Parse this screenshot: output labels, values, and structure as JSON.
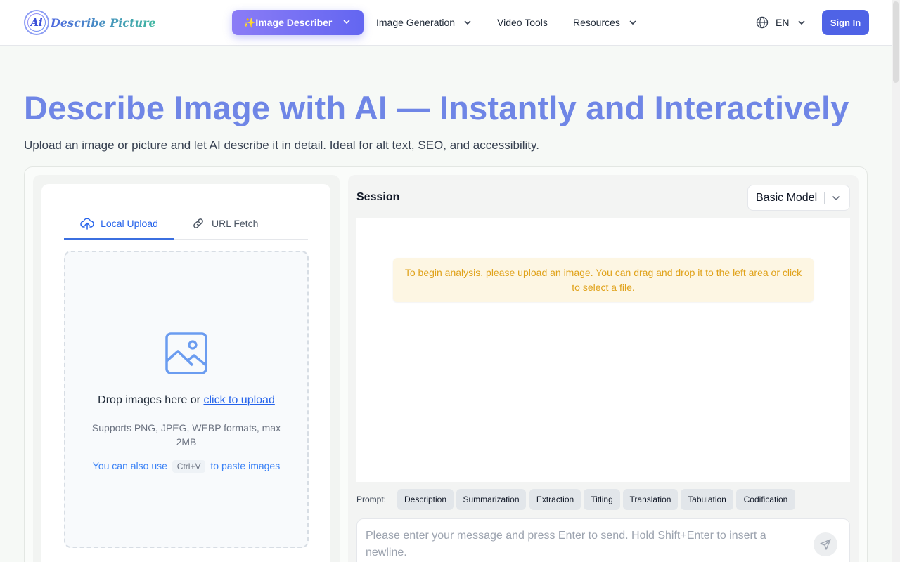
{
  "header": {
    "logo_text": "Describe Picture",
    "logo_badge": "Ai",
    "nav": {
      "image_describer": "✨Image Describer",
      "image_generation": "Image Generation",
      "video_tools": "Video Tools",
      "resources": "Resources"
    },
    "language": "EN",
    "sign_in": "Sign In"
  },
  "hero": {
    "title": "Describe Image with AI — Instantly and Interactively",
    "subtitle": "Upload an image or picture and let AI describe it in detail. Ideal for alt text, SEO, and accessibility."
  },
  "upload": {
    "tabs": [
      "Local Upload",
      "URL Fetch"
    ],
    "drop_text": "Drop images here or",
    "click_link": "click to upload",
    "supports": "Supports PNG, JPEG, WEBP formats, max 2MB",
    "paste_prefix": "You can also use",
    "paste_key": "Ctrl+V",
    "paste_suffix": "to paste images"
  },
  "session": {
    "title": "Session",
    "model": "Basic Model",
    "notice": "To begin analysis, please upload an image. You can drag and drop it to the left area or click to select a file.",
    "prompt_label": "Prompt:",
    "prompts": [
      "Description",
      "Summarization",
      "Extraction",
      "Titling",
      "Translation",
      "Tabulation",
      "Codification"
    ],
    "input_placeholder": "Please enter your message and press Enter to send. Hold Shift+Enter to insert a newline."
  },
  "colors": {
    "accent": "#4f63e6",
    "hero_title": "#6f86e6",
    "notice_text": "#e0a21a",
    "link": "#2563eb"
  },
  "icons": [
    "globe-icon",
    "chevron-down-icon",
    "upload-cloud-icon",
    "link-icon",
    "image-icon",
    "send-icon"
  ]
}
